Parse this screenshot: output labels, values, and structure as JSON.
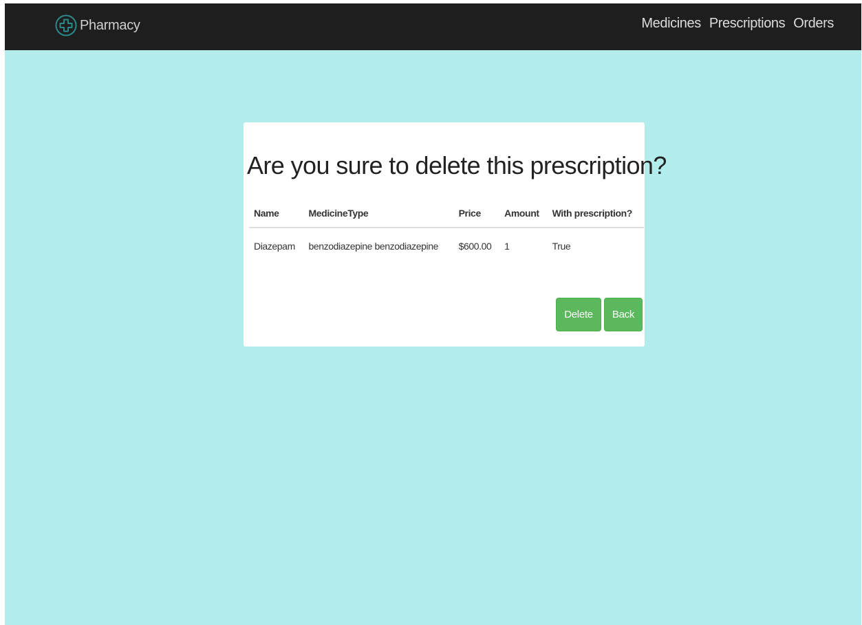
{
  "navbar": {
    "brand": "Pharmacy",
    "links": [
      "Medicines",
      "Prescriptions",
      "Orders"
    ]
  },
  "dialog": {
    "title": "Are you sure to delete this prescription?",
    "table": {
      "headers": [
        "Name",
        "MedicineType",
        "Price",
        "Amount",
        "With prescription?"
      ],
      "rows": [
        [
          "Diazepam",
          "benzodiazepine benzodiazepine",
          "$600.00",
          "1",
          "True"
        ]
      ]
    },
    "buttons": {
      "delete": "Delete",
      "back": "Back"
    }
  },
  "colors": {
    "background": "#b2eced",
    "navbar": "#1e1e1e",
    "button": "#5cb85c",
    "brand_icon": "#2a8a8a"
  },
  "icons": {
    "brand": "plus-circle-icon"
  }
}
